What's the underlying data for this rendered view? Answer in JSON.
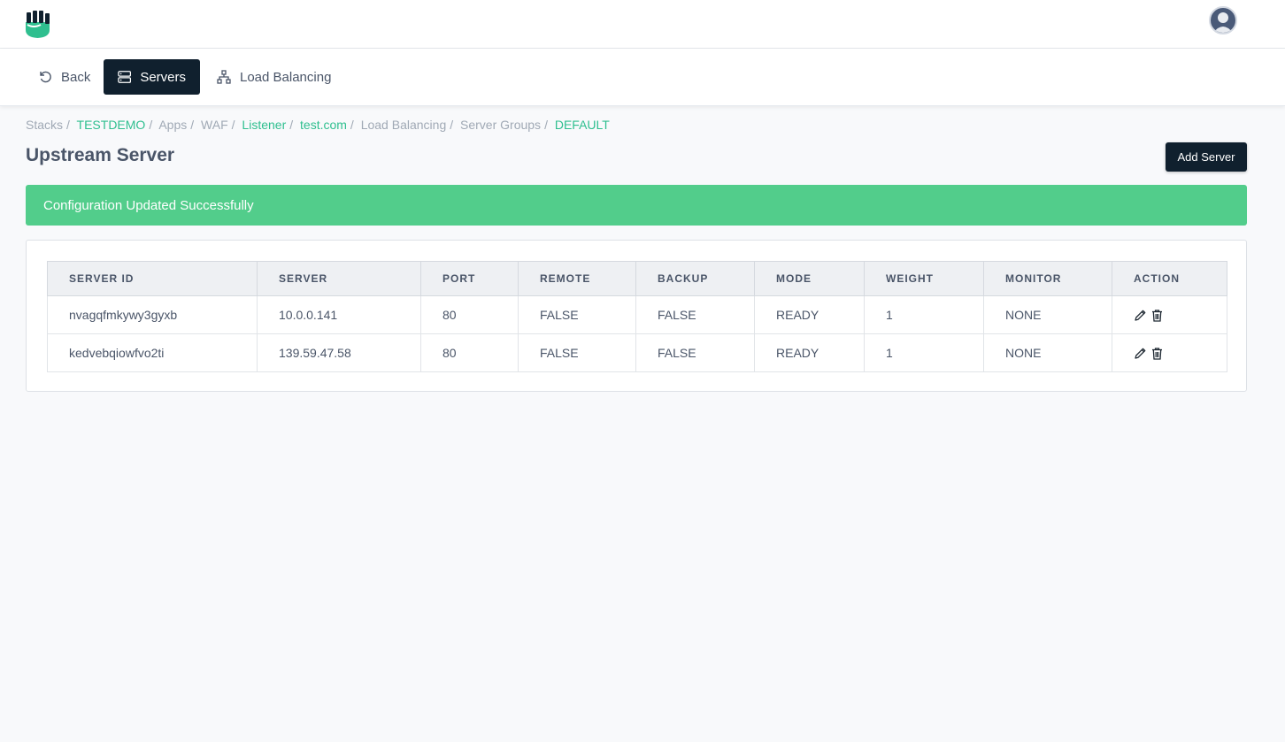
{
  "header": {
    "logo": "fist-shield-logo",
    "avatar": "user-avatar-icon"
  },
  "subnav": {
    "back_label": "Back",
    "servers_label": "Servers",
    "load_balancing_label": "Load Balancing"
  },
  "breadcrumb": [
    {
      "label": "Stacks",
      "link": false
    },
    {
      "label": "TESTDEMO",
      "link": true
    },
    {
      "label": "Apps",
      "link": false
    },
    {
      "label": "WAF",
      "link": false
    },
    {
      "label": "Listener",
      "link": true
    },
    {
      "label": "test.com",
      "link": true
    },
    {
      "label": "Load Balancing",
      "link": false
    },
    {
      "label": "Server Groups",
      "link": false
    },
    {
      "label": "DEFAULT",
      "link": true
    }
  ],
  "page": {
    "title": "Upstream Server",
    "add_button": "Add Server",
    "alert": "Configuration Updated Successfully"
  },
  "table": {
    "columns": [
      "SERVER ID",
      "SERVER",
      "PORT",
      "REMOTE",
      "BACKUP",
      "MODE",
      "WEIGHT",
      "MONITOR",
      "ACTION"
    ],
    "rows": [
      {
        "id": "nvagqfmkywy3gyxb",
        "server": "10.0.0.141",
        "port": "80",
        "remote": "FALSE",
        "backup": "FALSE",
        "mode": "READY",
        "weight": "1",
        "monitor": "NONE"
      },
      {
        "id": "kedvebqiowfvo2ti",
        "server": "139.59.47.58",
        "port": "80",
        "remote": "FALSE",
        "backup": "FALSE",
        "mode": "READY",
        "weight": "1",
        "monitor": "NONE"
      }
    ]
  },
  "colors": {
    "accent": "#2fbf8f",
    "dark": "#10202e",
    "success": "#52cd8b"
  }
}
